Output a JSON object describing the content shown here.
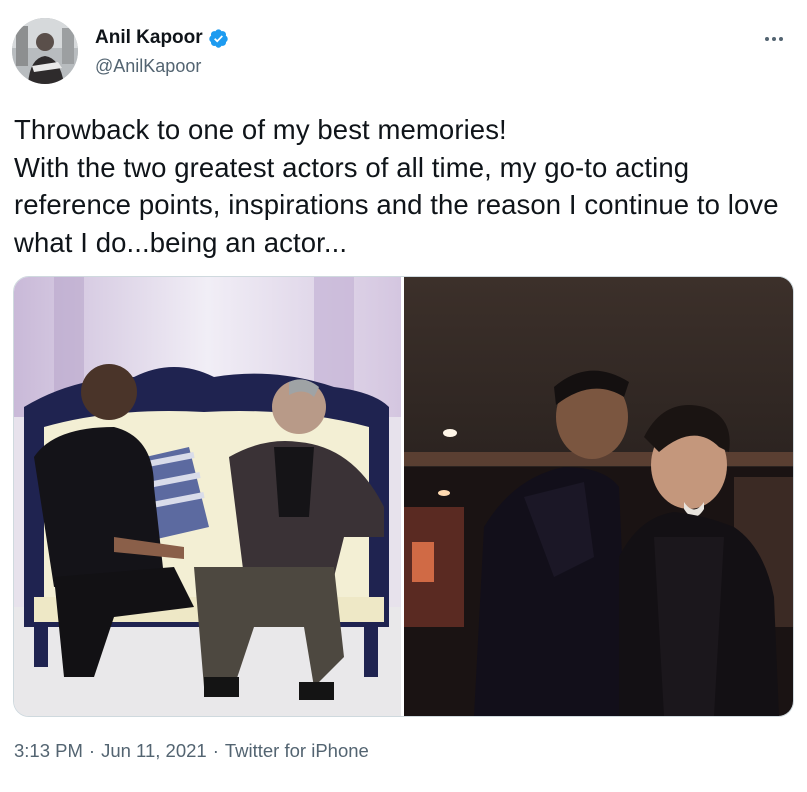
{
  "author": {
    "display_name": "Anil Kapoor",
    "handle": "@AnilKapoor",
    "verified": true,
    "avatar_icon": "profile-photo",
    "verified_color": "#1d9bf0"
  },
  "menu": {
    "icon": "more-horizontal-icon"
  },
  "tweet": {
    "text": "Throwback to one of my best memories!\nWith the two greatest actors of all time, my go-to acting reference points, inspirations and the reason I continue to love what I do...being an actor..."
  },
  "media": {
    "photos": [
      {
        "icon": "photo-two-men-seated-on-sofa"
      },
      {
        "icon": "photo-two-men-standing-night"
      }
    ]
  },
  "footer": {
    "time": "3:13 PM",
    "date": "Jun 11, 2021",
    "source": "Twitter for iPhone",
    "separator": "·"
  },
  "colors": {
    "text_primary": "#0f1419",
    "text_secondary": "#536471",
    "border": "#cfd9de"
  }
}
